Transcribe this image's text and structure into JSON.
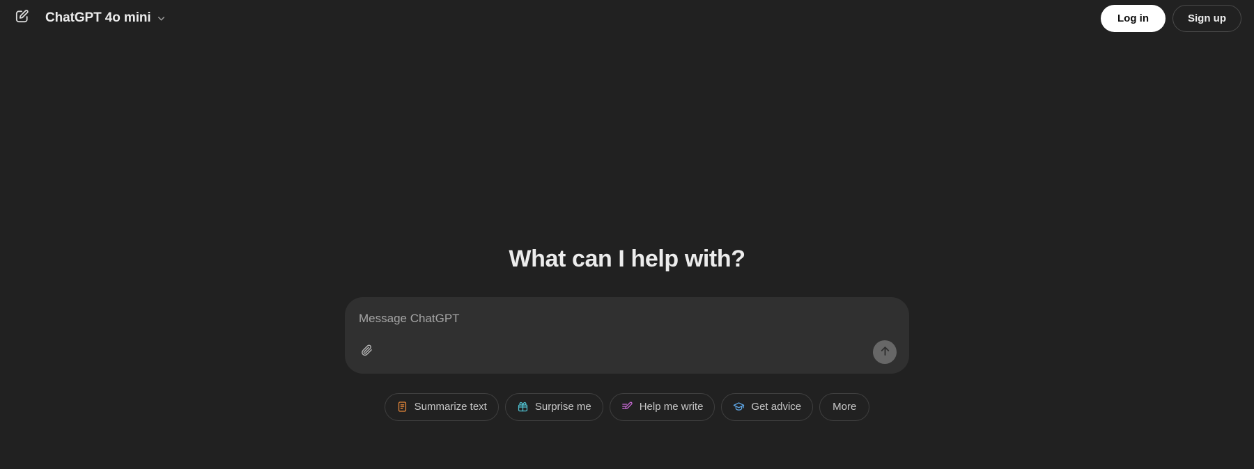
{
  "header": {
    "compose_icon": "compose-square-pen-icon",
    "model_name": "ChatGPT 4o mini",
    "model_chevron_icon": "chevron-down-icon",
    "login_label": "Log in",
    "signup_label": "Sign up"
  },
  "main": {
    "headline": "What can I help with?",
    "composer": {
      "placeholder": "Message ChatGPT",
      "attach_icon": "paperclip-icon",
      "send_icon": "arrow-up-icon"
    },
    "chips": [
      {
        "label": "Summarize text",
        "icon": "document-text-icon",
        "color": "#e8883a"
      },
      {
        "label": "Surprise me",
        "icon": "gift-box-icon",
        "color": "#4fc0d0"
      },
      {
        "label": "Help me write",
        "icon": "pencil-lines-icon",
        "color": "#cc6bd9"
      },
      {
        "label": "Get advice",
        "icon": "graduation-cap-icon",
        "color": "#5fa8e8"
      },
      {
        "label": "More",
        "icon": "",
        "color": ""
      }
    ]
  },
  "colors": {
    "page_background": "#212121",
    "composer_background": "#303030",
    "text_primary": "#ececec",
    "text_muted": "#a5a5a5",
    "login_button_background": "#ffffff",
    "send_button_background": "#676767"
  }
}
